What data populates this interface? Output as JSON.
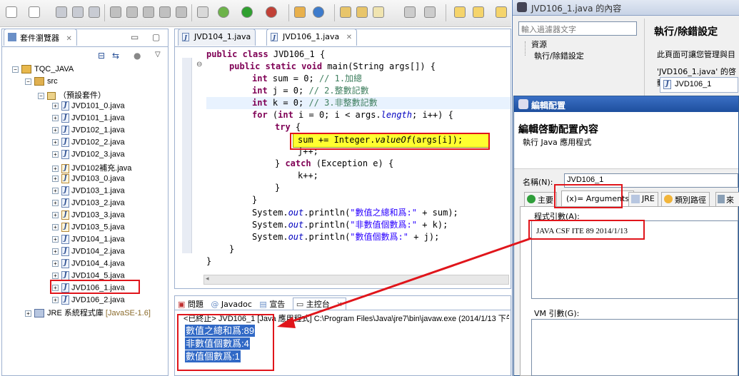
{
  "toolbar": {
    "icons": [
      "new-file-icon",
      "new-folder-icon",
      "save-icon",
      "save-all-icon",
      "print-icon",
      "build-icon",
      "run-icon",
      "refactor-icon",
      "window-icon",
      "debug-icon",
      "skip-icon",
      "run-ext-icon",
      "debug-ext-icon",
      "package-icon",
      "open-type-icon",
      "folder-icon",
      "open-folder-icon",
      "brush-icon",
      "task-icon",
      "back-icon",
      "forward-icon",
      "nav-icon"
    ]
  },
  "package_explorer": {
    "title": "套件瀏覽器",
    "project": "TQC_JAVA",
    "src": "src",
    "default_package": "（預設套件）",
    "files": [
      "JVD101_0.java",
      "JVD101_1.java",
      "JVD102_1.java",
      "JVD102_2.java",
      "JVD102_3.java",
      "JVD102補充.java",
      "JVD103_0.java",
      "JVD103_1.java",
      "JVD103_2.java",
      "JVD103_3.java",
      "JVD103_5.java",
      "JVD104_1.java",
      "JVD104_2.java",
      "JVD104_4.java",
      "JVD104_5.java",
      "JVD106_1.java",
      "JVD106_2.java"
    ],
    "jre": "JRE 系統程式庫",
    "jre_version": "[JavaSE-1.6]"
  },
  "editor": {
    "tabs": [
      "JVD104_1.java",
      "JVD106_1.java"
    ],
    "code": {
      "l1_kw": "public class",
      "l1_rest": " JVD106_1 {",
      "l2_kw": "public static void",
      "l2_rest": " main(String args[]) {",
      "l3_kw": "int",
      "l3_rest": " sum = 0; ",
      "l3_cm": "// 1.加總",
      "l4_kw": "int",
      "l4_rest": " j = 0; ",
      "l4_cm": "// 2.整數記數",
      "l5_kw": "int",
      "l5_rest": " k = 0; ",
      "l5_cm": "// 3.非整數記數",
      "l6_kw": "for",
      "l6_a": " (",
      "l6_kw2": "int",
      "l6_b": " i = 0; i < args.",
      "l6_fld": "length",
      "l6_c": "; i++) {",
      "l7_kw": "try",
      "l7_rest": " {",
      "tooltip_a": "sum += Integer.",
      "tooltip_it": "valueOf",
      "tooltip_b": "(args[i]);",
      "l9": "j++;",
      "l10_a": "} ",
      "l10_kw": "catch",
      "l10_b": " (Exception e) {",
      "l11": "k++;",
      "l12": "}",
      "l13": "}",
      "sys_a": "System.",
      "sys_out": "out",
      "sys_b": ".println(",
      "s1": "\"數值之總和爲:\"",
      "s1_tail": " + sum);",
      "s2": "\"非數值個數爲:\"",
      "s2_tail": " + k);",
      "s3": "\"數值個數爲:\"",
      "s3_tail": " + j);",
      "close1": "}",
      "close2": "}"
    }
  },
  "console": {
    "tabs": [
      "問題",
      "Javadoc",
      "宣告",
      "主控台"
    ],
    "header": "<已終止> JVD106_1 [Java 應用程式] C:\\Program Files\\Java\\jre7\\bin\\javaw.exe (2014/1/13 下午2",
    "lines": [
      "數值之總和爲:89",
      "非數值個數爲:4",
      "數值個數爲:1"
    ]
  },
  "debug_dialog": {
    "title": "JVD106_1.java 的內容",
    "filter_placeholder": "輸入過濾器文字",
    "tree": [
      "資源",
      "執行/除錯設定"
    ],
    "section_title": "執行/除錯設定",
    "description": "此頁面可讓您管理與目",
    "launch_label": "'JVD106_1.java' 的啓動",
    "launch_item": "JVD106_1"
  },
  "edit_dialog": {
    "title": "編輯配置",
    "heading": "編輯啓動配置內容",
    "subheading": "執行 Java 應用程式",
    "name_label": "名稱(N):",
    "name_value": "JVD106_1",
    "tabs": [
      "主要",
      "(x)= Arguments",
      "JRE",
      "類別路徑",
      "來"
    ],
    "program_args_label": "程式引數(A):",
    "program_args_value": "JAVA CSF ITE 89 2014/1/13",
    "vm_args_label": "VM 引數(G):"
  },
  "colors": {
    "highlight": "#3169c6",
    "red_annotation": "#e0151b",
    "tooltip_bg": "#ffff30"
  }
}
